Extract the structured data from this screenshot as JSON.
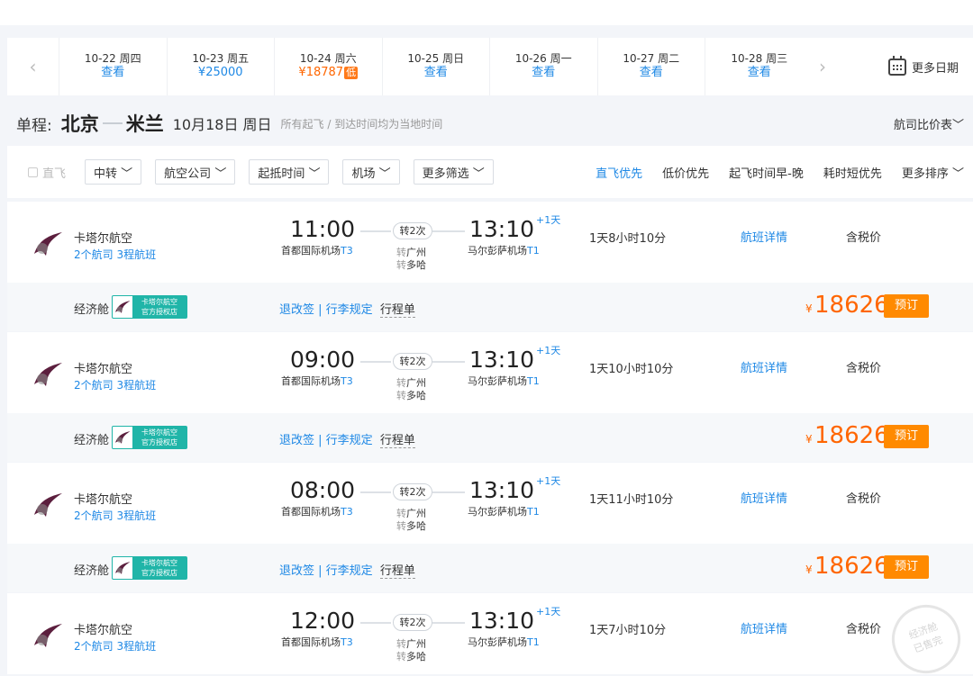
{
  "nav": {
    "prev_icon": "chevron-left-icon",
    "next_icon": "chevron-right-icon"
  },
  "dates": [
    {
      "date": "10-22",
      "weekday": "周四",
      "price": "查看"
    },
    {
      "date": "10-23",
      "weekday": "周五",
      "price": "¥25000"
    },
    {
      "date": "10-24",
      "weekday": "周六",
      "price": "¥18787",
      "badge": "低",
      "active": true
    },
    {
      "date": "10-25",
      "weekday": "周日",
      "price": "查看"
    },
    {
      "date": "10-26",
      "weekday": "周一",
      "price": "查看"
    },
    {
      "date": "10-27",
      "weekday": "周二",
      "price": "查看"
    },
    {
      "date": "10-28",
      "weekday": "周三",
      "price": "查看"
    }
  ],
  "more_dates": "更多日期",
  "route": {
    "label": "单程:",
    "from": "北京",
    "to": "米兰",
    "date": "10月18日 周日",
    "note": "所有起飞 / 到达时间均为当地时间",
    "compare": "航司比价表"
  },
  "filters": {
    "direct": "直飞",
    "buttons": [
      "中转",
      "航空公司",
      "起抵时间",
      "机场",
      "更多筛选"
    ],
    "sorts": [
      "直飞优先",
      "低价优先",
      "起飞时间早-晚",
      "耗时短优先",
      "更多排序"
    ]
  },
  "flights": [
    {
      "airline": "卡塔尔航空",
      "sub": "2个航司  3程航班",
      "dep": "11:00",
      "dep_airport": "首都国际机场",
      "dep_term": "T3",
      "stops": "转2次",
      "via1": "广州",
      "via2": "多哈",
      "arr": "13:10",
      "plus": "+1天",
      "arr_airport": "马尔彭萨机场",
      "arr_term": "T1",
      "duration": "1天8小时10分",
      "detail": "航班详情",
      "tax": "含税价",
      "cabin": "经济舱",
      "auth_top": "卡塔尔航空",
      "auth_bottom": "官方授权店",
      "rules": "退改签 | 行李规定",
      "itinerary": "行程单",
      "currency": "¥",
      "price": "18626",
      "book": "预订"
    },
    {
      "airline": "卡塔尔航空",
      "sub": "2个航司  3程航班",
      "dep": "09:00",
      "dep_airport": "首都国际机场",
      "dep_term": "T3",
      "stops": "转2次",
      "via1": "广州",
      "via2": "多哈",
      "arr": "13:10",
      "plus": "+1天",
      "arr_airport": "马尔彭萨机场",
      "arr_term": "T1",
      "duration": "1天10小时10分",
      "detail": "航班详情",
      "tax": "含税价",
      "cabin": "经济舱",
      "auth_top": "卡塔尔航空",
      "auth_bottom": "官方授权店",
      "rules": "退改签 | 行李规定",
      "itinerary": "行程单",
      "currency": "¥",
      "price": "18626",
      "book": "预订"
    },
    {
      "airline": "卡塔尔航空",
      "sub": "2个航司  3程航班",
      "dep": "08:00",
      "dep_airport": "首都国际机场",
      "dep_term": "T3",
      "stops": "转2次",
      "via1": "广州",
      "via2": "多哈",
      "arr": "13:10",
      "plus": "+1天",
      "arr_airport": "马尔彭萨机场",
      "arr_term": "T1",
      "duration": "1天11小时10分",
      "detail": "航班详情",
      "tax": "含税价",
      "cabin": "经济舱",
      "auth_top": "卡塔尔航空",
      "auth_bottom": "官方授权店",
      "rules": "退改签 | 行李规定",
      "itinerary": "行程单",
      "currency": "¥",
      "price": "18626",
      "book": "预订"
    },
    {
      "airline": "卡塔尔航空",
      "sub": "2个航司  3程航班",
      "dep": "12:00",
      "dep_airport": "首都国际机场",
      "dep_term": "T3",
      "stops": "转2次",
      "via1": "广州",
      "via2": "多哈",
      "arr": "13:10",
      "plus": "+1天",
      "arr_airport": "马尔彭萨机场",
      "arr_term": "T1",
      "duration": "1天7小时10分",
      "detail": "航班详情",
      "tax": "含税价"
    }
  ],
  "via_prefix": "转",
  "soldout": {
    "line1": "经济舱",
    "line2": "已售完"
  },
  "colors": {
    "accent": "#1e88e5",
    "price": "#ff6600",
    "book": "#ff8a00",
    "auth": "#20b5a8"
  }
}
